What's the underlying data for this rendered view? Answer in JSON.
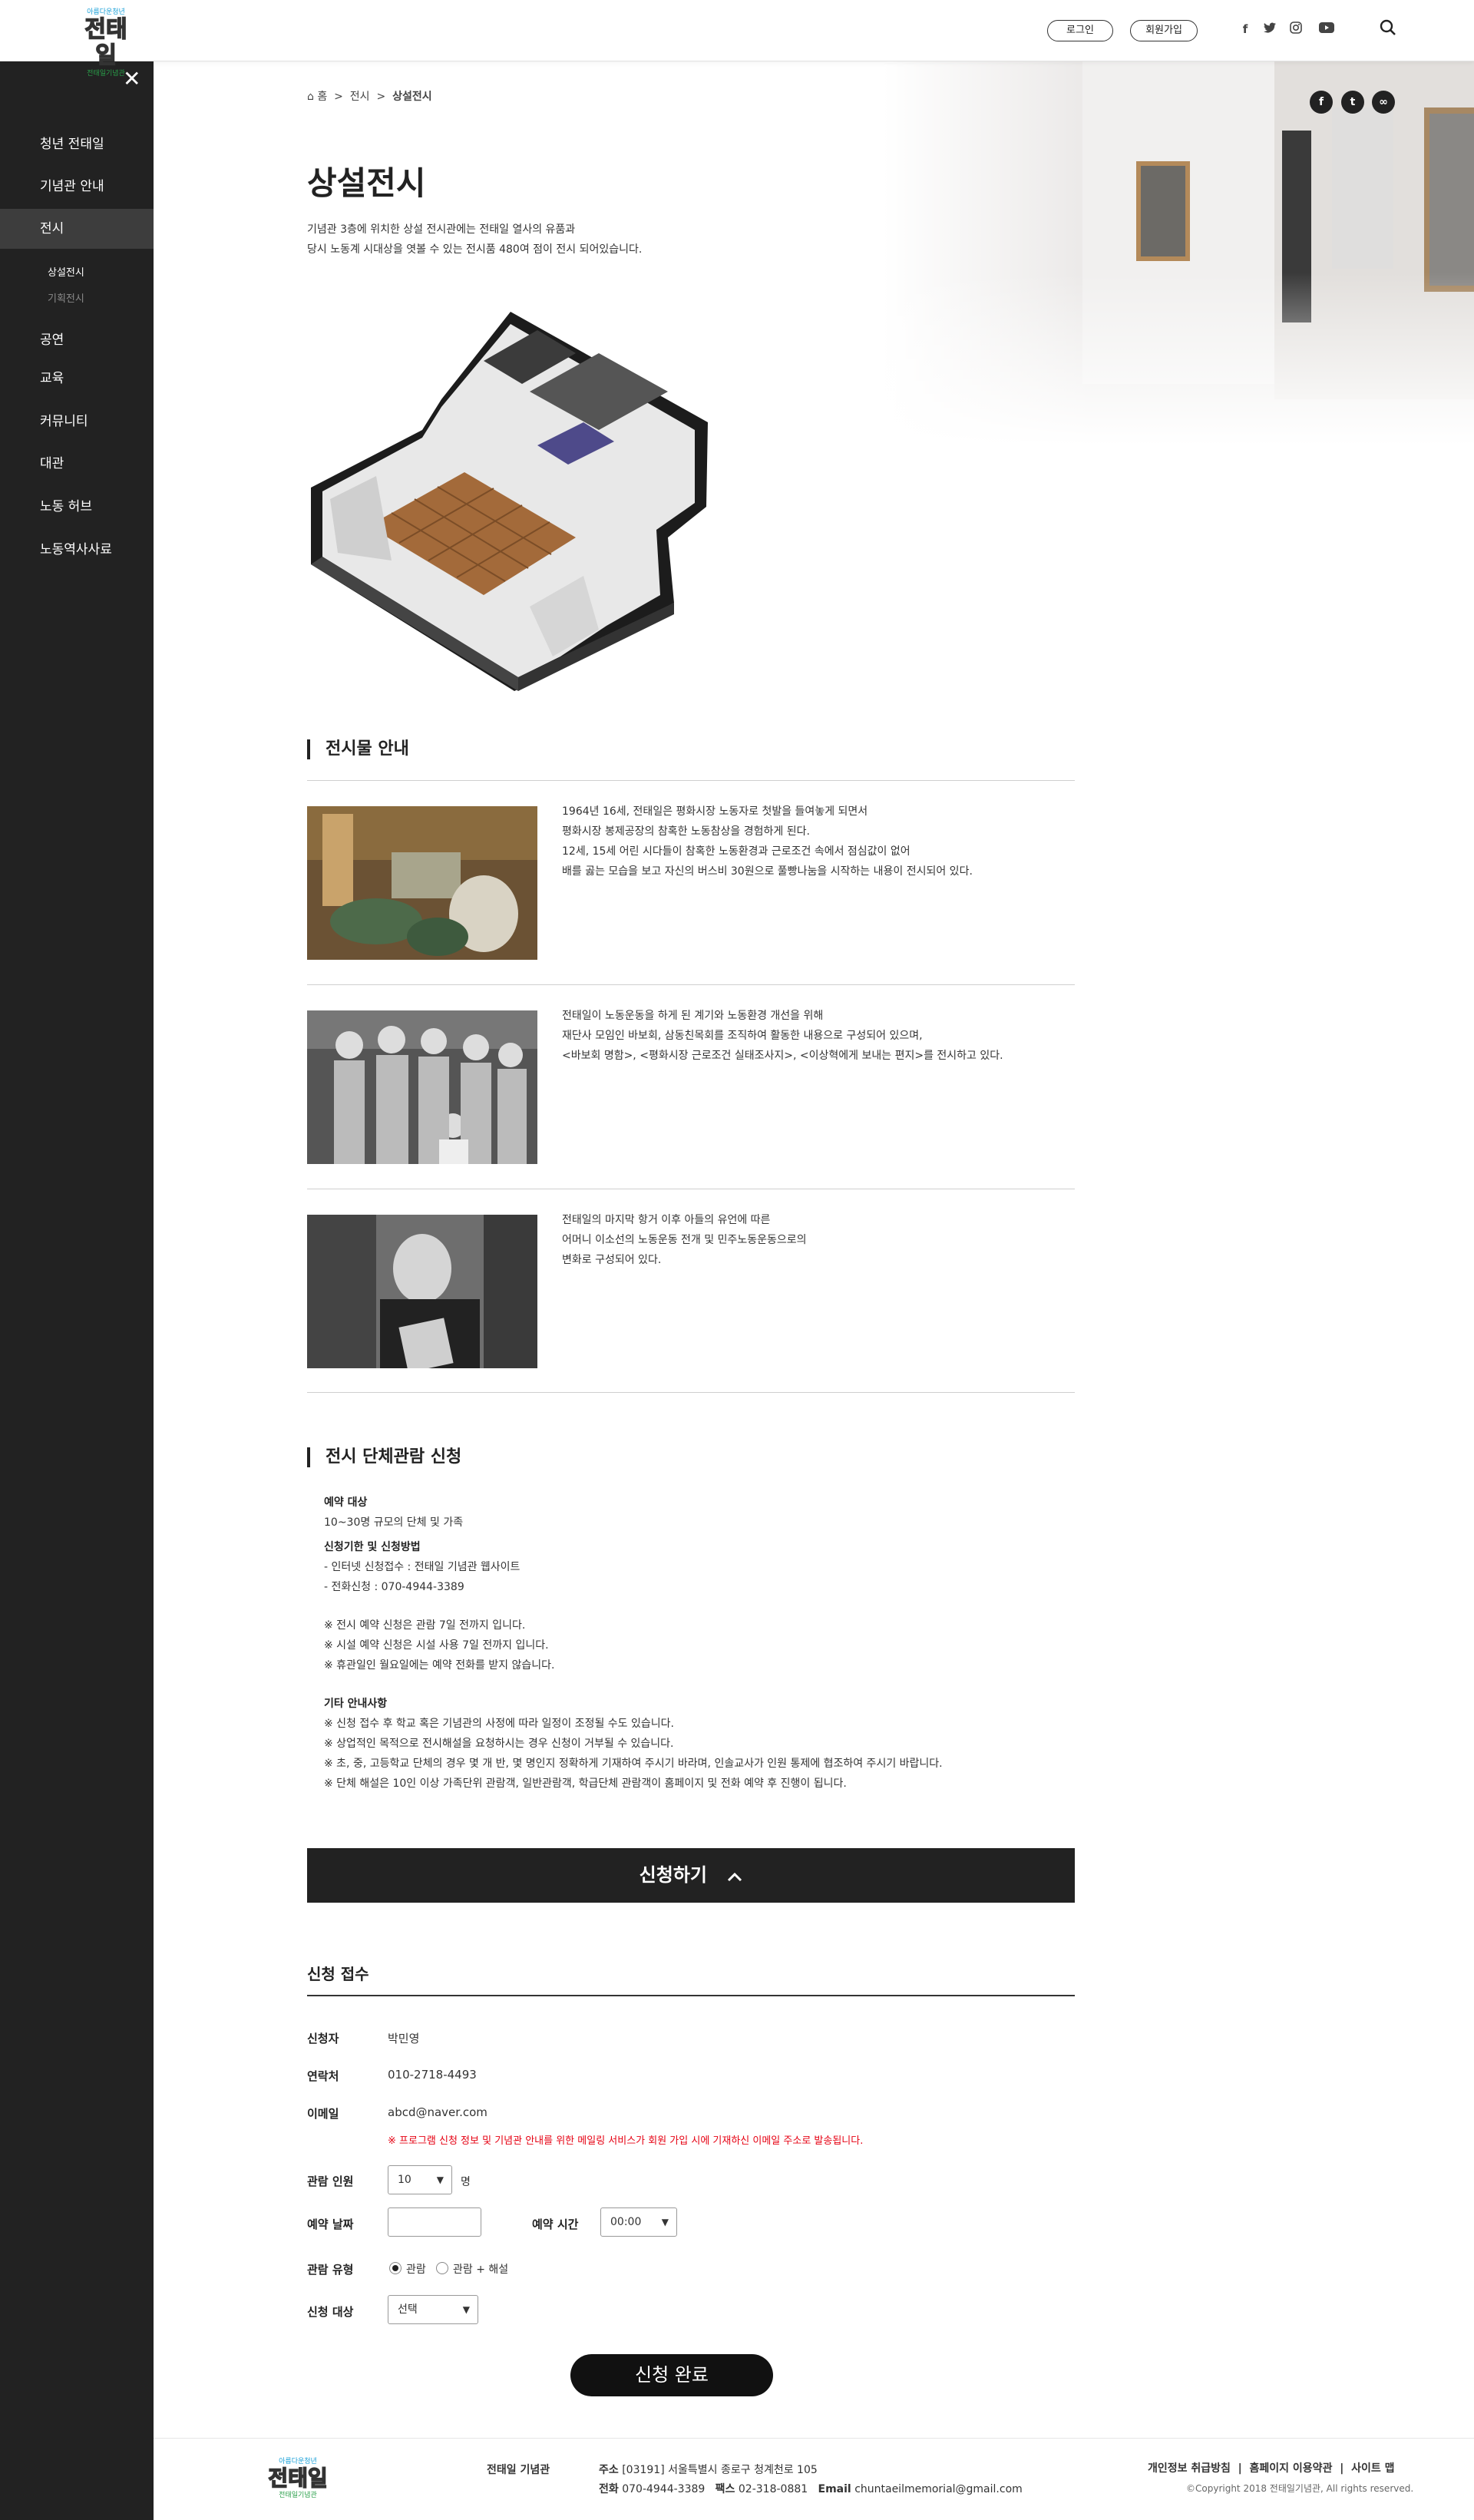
{
  "header": {
    "logo_top": "아름다운청년",
    "logo_main": "전태일",
    "logo_sub": "전태일기념관",
    "login": "로그인",
    "signup": "회원가입",
    "social": [
      "f",
      "t",
      "ig",
      "yt"
    ],
    "search_icon": "search-icon"
  },
  "sidebar": {
    "close_icon": "close-icon",
    "items": [
      {
        "label": "청년 전태일"
      },
      {
        "label": "기념관 안내"
      },
      {
        "label": "전시"
      },
      {
        "label": "공연"
      },
      {
        "label": "교육"
      },
      {
        "label": "커뮤니티"
      },
      {
        "label": "대관"
      },
      {
        "label": "노동 허브"
      },
      {
        "label": "노동역사사료"
      }
    ],
    "sub_items": [
      {
        "label": "상설전시"
      },
      {
        "label": "기획전시"
      }
    ]
  },
  "breadcrumb": {
    "home": "홈",
    "sep": ">",
    "level1": "전시",
    "level2": "상설전시"
  },
  "share": {
    "facebook": "f",
    "twitter": "t",
    "link": "∞"
  },
  "page": {
    "title": "상설전시",
    "intro_line1": "기념관 3층에 위치한 상설 전시관에는 전태일 열사의 유품과",
    "intro_line2": "당시 노동계 시대상을 엿볼 수 있는 전시품 480여 점이 전시 되어있습니다."
  },
  "exhibits": {
    "title": "전시물 안내",
    "items": [
      {
        "text": "1964년 16세, 전태일은 평화시장 노동자로 첫발을 들여놓게 되면서\n평화시장 봉제공장의 참혹한 노동참상을 경험하게 된다.\n12세, 15세 어린 시다들이 참혹한 노동환경과 근로조건 속에서 점심값이 없어\n배를 곯는 모습을 보고 자신의 버스비 30원으로 풀빵나눔을 시작하는 내용이 전시되어 있다."
      },
      {
        "text": "전태일이 노동운동을 하게 된 계기와 노동환경 개선을 위해\n재단사 모임인 바보회, 삼동친목회를 조직하여 활동한 내용으로 구성되어 있으며,\n<바보회 명함>, <평화시장 근로조건 실태조사지>, <이상혁에게 보내는 편지>를 전시하고 있다."
      },
      {
        "text": "전태일의 마지막 항거 이후 아들의 유언에 따른\n어머니 이소선의 노동운동 전개 및 민주노동운동으로의\n변화로 구성되어 있다."
      }
    ]
  },
  "group": {
    "title": "전시 단체관람 신청",
    "target_head": "예약 대상",
    "target_text": "10~30명 규모의 단체 및 가족",
    "method_head": "신청기한 및 신청방법",
    "method_1": " - 인터넷 신청접수 : 전태일 기념관 웹사이트",
    "method_2": " - 전화신청 : 070-4944-3389",
    "note_1": "※ 전시 예약 신청은 관람 7일 전까지 입니다.",
    "note_2": "※ 시설 예약 신청은 시설 사용 7일 전까지 입니다.",
    "note_3": "※ 휴관일인 월요일에는 예약 전화를 받지 않습니다.",
    "etc_head": "기타 안내사항",
    "etc_1": "※ 신청 접수 후 학교 혹은 기념관의 사정에 따라 일정이 조정될 수도 있습니다.",
    "etc_2": "※ 상업적인 목적으로 전시해설을 요청하시는 경우 신청이 거부될 수 있습니다.",
    "etc_3": "※ 초, 중, 고등학교 단체의 경우 몇 개 반, 몇 명인지 정확하게 기재하여 주시기 바라며, 인솔교사가 인원 통제에 협조하여 주시기 바랍니다.",
    "etc_4": "※ 단체 해설은 10인 이상 가족단위 관람객, 일반관람객, 학급단체 관람객이 홈페이지 및 전화 예약 후 진행이 됩니다."
  },
  "apply_button": "신청하기",
  "form": {
    "title": "신청 접수",
    "applicant_label": "신청자",
    "applicant_value": "박민영",
    "contact_label": "연락처",
    "contact_value": "010-2718-4493",
    "email_label": "이메일",
    "email_value": "abcd@naver.com",
    "email_notice": "※ 프로그램 신청 정보 및 기념관 안내를 위한 메일링 서비스가 회원 가입 시에 기재하신 이메일 주소로 발송됩니다.",
    "people_label": "관람 인원",
    "people_value": "10",
    "people_unit": "명",
    "date_label": "예약 날짜",
    "date_value": "",
    "time_label": "예약 시간",
    "time_value": "00:00",
    "type_label": "관람 유형",
    "type_opt1": "관람",
    "type_opt2": "관람 + 해설",
    "audience_label": "신청 대상",
    "audience_value": "선택",
    "submit": "신청 완료"
  },
  "footer": {
    "name": "전태일 기념관",
    "addr_label": "주소",
    "addr": "[03191] 서울특별시 종로구 청계천로 105",
    "tel_label": "전화",
    "tel": "070-4944-3389",
    "fax_label": "팩스",
    "fax": "02-318-0881",
    "email_label": "Email",
    "email": "chuntaeilmemorial@gmail.com",
    "link1": "개인정보 취급방침",
    "link2": "홈페이지 이용약관",
    "link3": "사이트 맵",
    "copyright": "©Copyright 2018 전태일기념관, All rights reserved."
  },
  "colors": {
    "dark": "#222222",
    "sidebar_active": "#3d3d3d",
    "notice_red": "#e60012",
    "logo_blue": "#19a0d8",
    "logo_green": "#2aa04a"
  }
}
